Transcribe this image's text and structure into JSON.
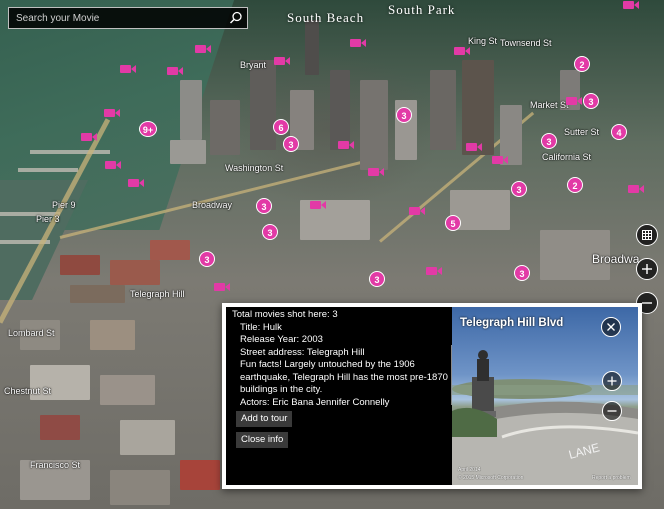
{
  "search": {
    "placeholder": "Search your Movie"
  },
  "map": {
    "districts": [
      "South Beach",
      "South Park"
    ],
    "streets": [
      "Bryant",
      "King St",
      "Townsend St",
      "Washington St",
      "Broadway",
      "Pier 9",
      "Pier 3",
      "Telegraph Hill",
      "Lombard St",
      "Chestnut St",
      "Francisco St",
      "Market St",
      "Sutter St",
      "California St",
      "Broadwa"
    ],
    "cluster_counts": [
      "3",
      "3",
      "6",
      "3",
      "3",
      "9+",
      "2",
      "3",
      "3",
      "3",
      "4",
      "2",
      "3",
      "5",
      "3",
      "3"
    ],
    "marker_color": "#e23aa6"
  },
  "controls": {
    "layers": "map-layers-icon",
    "zoom_in": "+",
    "zoom_out": "−"
  },
  "popup": {
    "total": "Total movies shot here: 3",
    "title": "Title:  Hulk",
    "release": "Release Year:  2003",
    "address": "Street address:  Telegraph Hill",
    "fun_facts": "Fun facts! Largely untouched by the 1906 earthquake, Telegraph Hill has the most pre-1870 buildings in the city.",
    "actors": "Actors:  Eric Bana    Jennifer Connelly",
    "add_button": "Add to tour",
    "close_info_button": "Close info",
    "photo": {
      "title": "Telegraph Hill Blvd",
      "date": "April 2014",
      "copyright": "© 2015 Microsoft Corporation",
      "report": "Report a problem"
    }
  }
}
